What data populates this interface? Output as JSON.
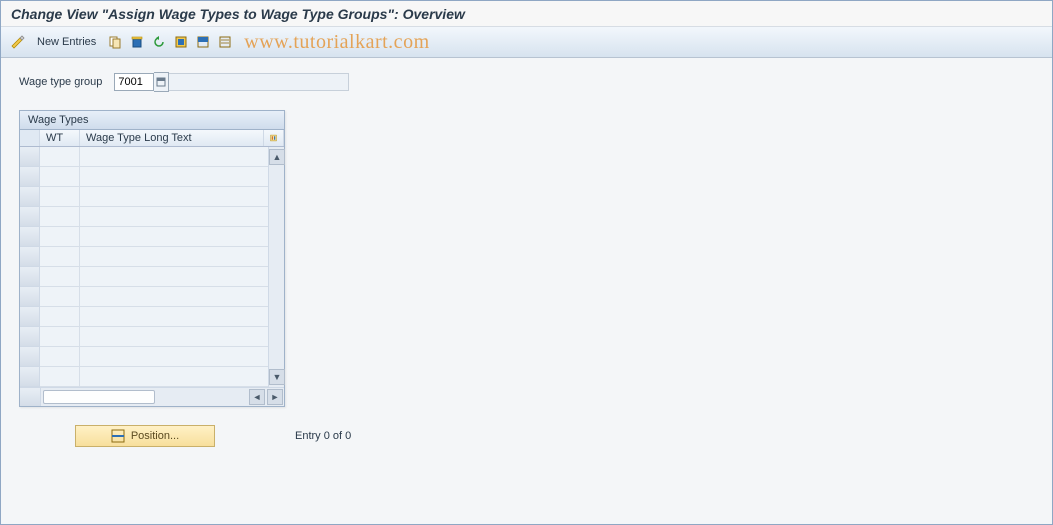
{
  "title": "Change View \"Assign Wage Types to Wage Type Groups\": Overview",
  "toolbar": {
    "new_entries_label": "New Entries"
  },
  "watermark": "www.tutorialkart.com",
  "field": {
    "label": "Wage type group",
    "value": "7001",
    "description": ""
  },
  "table": {
    "title": "Wage Types",
    "columns": {
      "wt": "WT",
      "long_text": "Wage Type Long Text"
    },
    "row_count": 12
  },
  "footer": {
    "position_label": "Position...",
    "entry_text": "Entry 0 of 0"
  }
}
